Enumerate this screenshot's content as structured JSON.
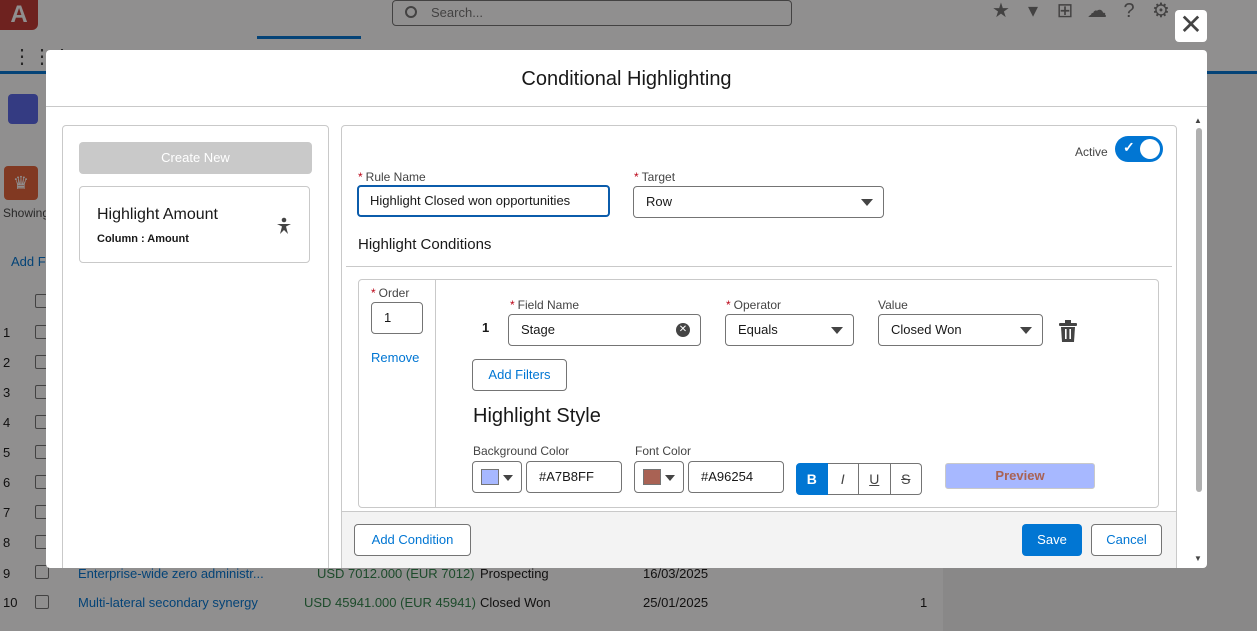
{
  "background": {
    "search_placeholder": "Search...",
    "showing_label": "Showing",
    "add_filter_label": "Add Fi",
    "row_numbers": [
      "1",
      "2",
      "3",
      "4",
      "5",
      "6",
      "7",
      "8",
      "9",
      "10"
    ],
    "rows": [
      {
        "name": "Enterprise-wide zero administr...",
        "amount": "USD 7012.000 (EUR 7012)",
        "stage": "Prospecting",
        "date": "16/03/2025",
        "num": ""
      },
      {
        "name": "Multi-lateral secondary synergy",
        "amount": "USD 45941.000 (EUR 45941)",
        "stage": "Closed Won",
        "date": "25/01/2025",
        "num": "1"
      }
    ]
  },
  "modal": {
    "title": "Conditional Highlighting",
    "close_icon": "close-icon",
    "left": {
      "create_new_label": "Create New",
      "rules": [
        {
          "title": "Highlight Amount",
          "subtitle": "Column : Amount",
          "icon": "pin-icon"
        }
      ]
    },
    "form": {
      "active_label": "Active",
      "active": true,
      "rule_name_label": "Rule Name",
      "rule_name_value": "Highlight Closed won opportunities",
      "target_label": "Target",
      "target_value": "Row",
      "section_title": "Highlight Conditions",
      "condition": {
        "order_label": "Order",
        "order_value": "1",
        "remove_label": "Remove",
        "row_number": "1",
        "field_name_label": "Field Name",
        "field_name_value": "Stage",
        "operator_label": "Operator",
        "operator_value": "Equals",
        "value_label": "Value",
        "value_value": "Closed Won",
        "add_filters_label": "Add Filters",
        "style_title": "Highlight Style",
        "bg_color_label": "Background Color",
        "bg_color_value": "#A7B8FF",
        "font_color_label": "Font Color",
        "font_color_value": "#A96254",
        "format_buttons": [
          {
            "label": "B",
            "name": "bold-button",
            "active": true
          },
          {
            "label": "I",
            "name": "italic-button",
            "active": false
          },
          {
            "label": "U",
            "name": "underline-button",
            "active": false
          },
          {
            "label": "S",
            "name": "strikethrough-button",
            "active": false
          }
        ],
        "preview_label": "Preview"
      }
    },
    "footer": {
      "add_condition_label": "Add Condition",
      "save_label": "Save",
      "cancel_label": "Cancel"
    }
  },
  "colors": {
    "brand": "#0176d3",
    "preview_bg": "#A7B8FF",
    "preview_font": "#A96254"
  }
}
